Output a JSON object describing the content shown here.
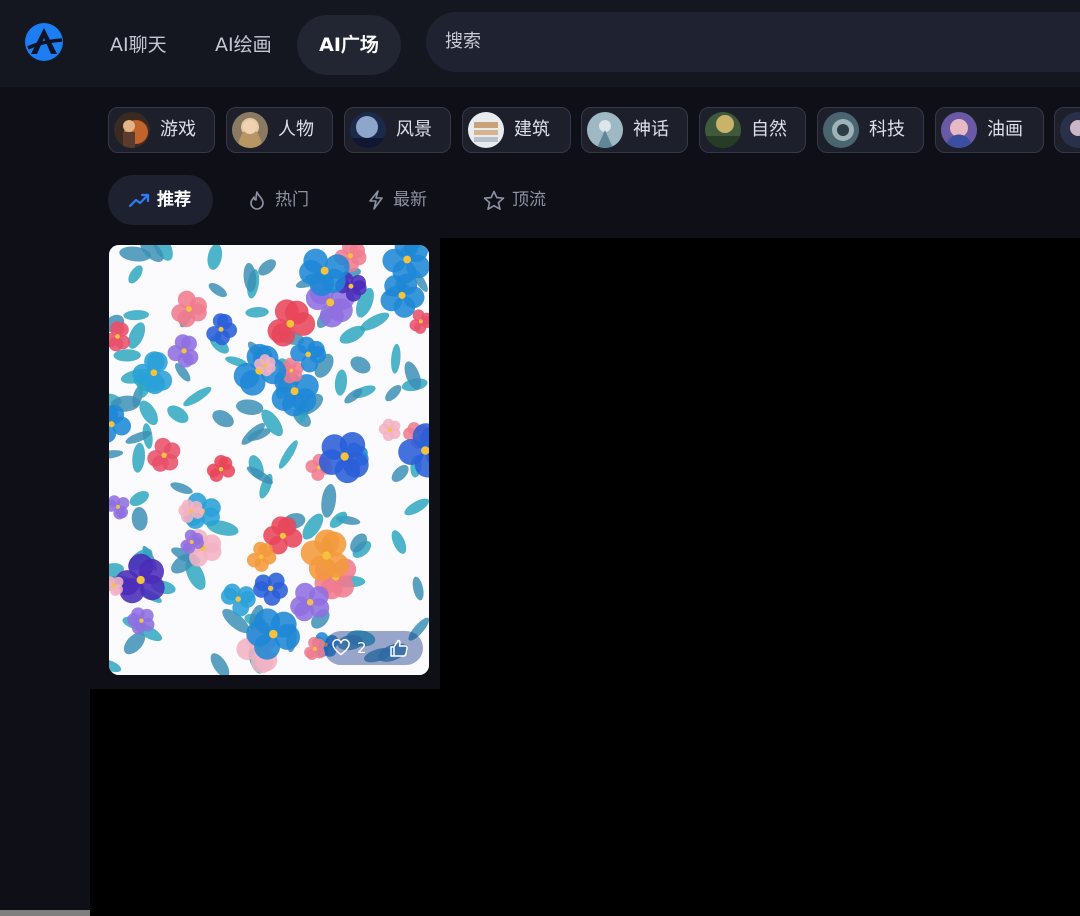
{
  "nav": {
    "tabs": [
      {
        "label": "AI聊天"
      },
      {
        "label": "AI绘画"
      },
      {
        "label": "AI广场"
      }
    ],
    "active_tab": "AI广场"
  },
  "search": {
    "placeholder": "搜索"
  },
  "categories": [
    {
      "label": "游戏",
      "icon": "game-category-thumbnail"
    },
    {
      "label": "人物",
      "icon": "character-category-thumbnail"
    },
    {
      "label": "风景",
      "icon": "landscape-category-thumbnail"
    },
    {
      "label": "建筑",
      "icon": "architecture-category-thumbnail"
    },
    {
      "label": "神话",
      "icon": "myth-category-thumbnail"
    },
    {
      "label": "自然",
      "icon": "nature-category-thumbnail"
    },
    {
      "label": "科技",
      "icon": "technology-category-thumbnail"
    },
    {
      "label": "油画",
      "icon": "oil-painting-category-thumbnail"
    }
  ],
  "sort_tabs": [
    {
      "label": "推荐",
      "icon": "trending-icon"
    },
    {
      "label": "热门",
      "icon": "flame-icon"
    },
    {
      "label": "最新",
      "icon": "lightning-icon"
    },
    {
      "label": "顶流",
      "icon": "star-icon"
    }
  ],
  "active_sort": "推荐",
  "gallery": [
    {
      "image": "watercolor-floral-pattern",
      "likes": "2"
    }
  ],
  "colors": {
    "background": "#0e0f17",
    "topbar": "#141620",
    "accent": "#2f7cf6",
    "chip_bg": "#1d202b"
  }
}
